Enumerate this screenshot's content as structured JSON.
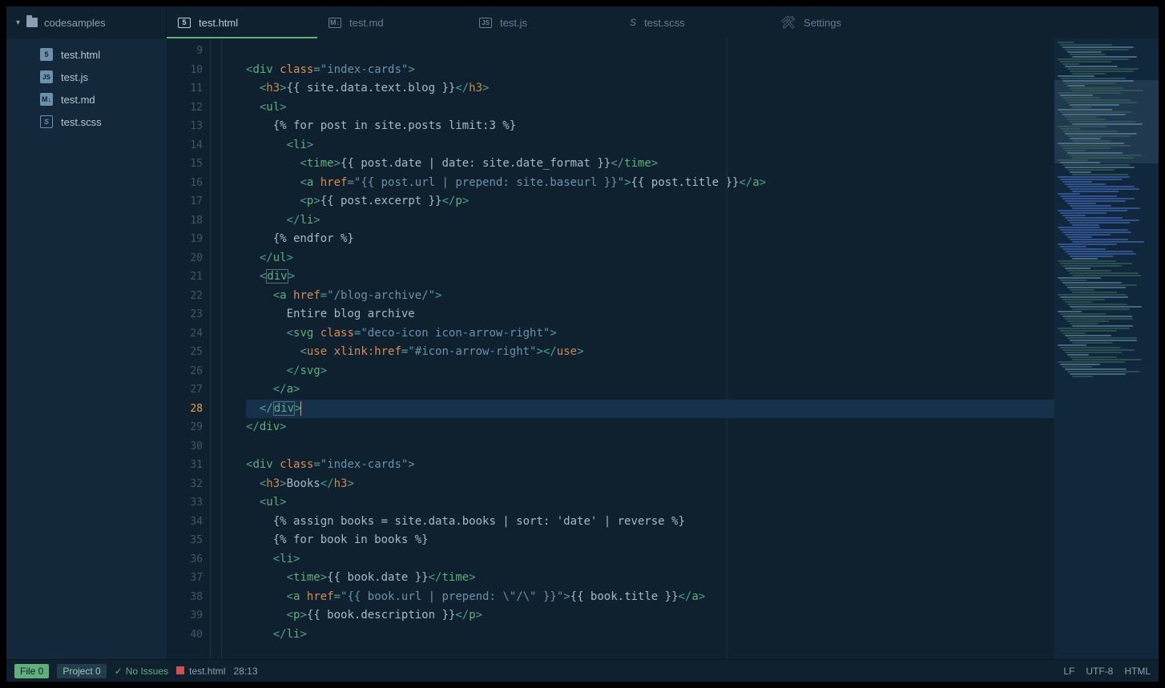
{
  "project": {
    "name": "codesamples"
  },
  "tabs": [
    {
      "label": "test.html",
      "icon": "5",
      "cls": "html",
      "active": true
    },
    {
      "label": "test.md",
      "icon": "M↓",
      "cls": "md"
    },
    {
      "label": "test.js",
      "icon": "JS",
      "cls": "js"
    },
    {
      "label": "test.scss",
      "icon": "S",
      "cls": "scss"
    },
    {
      "label": "Settings",
      "icon": "✕",
      "cls": "settings"
    }
  ],
  "files": [
    {
      "label": "test.html",
      "icon": "5",
      "cls": "html"
    },
    {
      "label": "test.js",
      "icon": "JS",
      "cls": "js"
    },
    {
      "label": "test.md",
      "icon": "M↓",
      "cls": "md"
    },
    {
      "label": "test.scss",
      "icon": "S",
      "cls": "scss"
    }
  ],
  "lines": {
    "start": 9,
    "end": 40,
    "active": 28
  },
  "code_lines": [
    {
      "n": 9,
      "indent": 0,
      "segs": []
    },
    {
      "n": 10,
      "indent": 0,
      "segs": [
        [
          "p",
          "<"
        ],
        [
          "tg",
          "div"
        ],
        [
          "tx",
          " "
        ],
        [
          "at",
          "class"
        ],
        [
          "p",
          "="
        ],
        [
          "st",
          "\"index-cards\""
        ],
        [
          "p",
          ">"
        ]
      ]
    },
    {
      "n": 11,
      "indent": 1,
      "segs": [
        [
          "p",
          "<"
        ],
        [
          "tg2",
          "h3"
        ],
        [
          "p",
          ">"
        ],
        [
          "tx",
          "{{ site.data.text.blog }}"
        ],
        [
          "p",
          "</"
        ],
        [
          "tg2",
          "h3"
        ],
        [
          "p",
          ">"
        ]
      ]
    },
    {
      "n": 12,
      "indent": 1,
      "segs": [
        [
          "p",
          "<"
        ],
        [
          "tg",
          "ul"
        ],
        [
          "p",
          ">"
        ]
      ]
    },
    {
      "n": 13,
      "indent": 2,
      "segs": [
        [
          "tx",
          "{% for post in site.posts limit:3 %}"
        ]
      ]
    },
    {
      "n": 14,
      "indent": 3,
      "segs": [
        [
          "p",
          "<"
        ],
        [
          "tg",
          "li"
        ],
        [
          "p",
          ">"
        ]
      ]
    },
    {
      "n": 15,
      "indent": 4,
      "segs": [
        [
          "p",
          "<"
        ],
        [
          "tg",
          "time"
        ],
        [
          "p",
          ">"
        ],
        [
          "tx",
          "{{ post.date | date: site.date_format }}"
        ],
        [
          "p",
          "</"
        ],
        [
          "tg",
          "time"
        ],
        [
          "p",
          ">"
        ]
      ]
    },
    {
      "n": 16,
      "indent": 4,
      "segs": [
        [
          "p",
          "<"
        ],
        [
          "tg",
          "a"
        ],
        [
          "tx",
          " "
        ],
        [
          "at",
          "href"
        ],
        [
          "p",
          "="
        ],
        [
          "st",
          "\"{{ post.url | prepend: site.baseurl }}\""
        ],
        [
          "p",
          ">"
        ],
        [
          "tx",
          "{{ post.title }}"
        ],
        [
          "p",
          "</"
        ],
        [
          "tg",
          "a"
        ],
        [
          "p",
          ">"
        ]
      ]
    },
    {
      "n": 17,
      "indent": 4,
      "segs": [
        [
          "p",
          "<"
        ],
        [
          "tg",
          "p"
        ],
        [
          "p",
          ">"
        ],
        [
          "tx",
          "{{ post.excerpt }}"
        ],
        [
          "p",
          "</"
        ],
        [
          "tg",
          "p"
        ],
        [
          "p",
          ">"
        ]
      ]
    },
    {
      "n": 18,
      "indent": 3,
      "segs": [
        [
          "p",
          "</"
        ],
        [
          "tg",
          "li"
        ],
        [
          "p",
          ">"
        ]
      ]
    },
    {
      "n": 19,
      "indent": 2,
      "segs": [
        [
          "tx",
          "{% endfor %}"
        ]
      ]
    },
    {
      "n": 20,
      "indent": 1,
      "segs": [
        [
          "p",
          "</"
        ],
        [
          "tg",
          "ul"
        ],
        [
          "p",
          ">"
        ]
      ]
    },
    {
      "n": 21,
      "indent": 1,
      "segs": [
        [
          "p",
          "<"
        ],
        [
          "match",
          "div"
        ],
        [
          "p",
          ">"
        ]
      ]
    },
    {
      "n": 22,
      "indent": 2,
      "segs": [
        [
          "p",
          "<"
        ],
        [
          "tg",
          "a"
        ],
        [
          "tx",
          " "
        ],
        [
          "at",
          "href"
        ],
        [
          "p",
          "="
        ],
        [
          "st",
          "\"/blog-archive/\""
        ],
        [
          "p",
          ">"
        ]
      ]
    },
    {
      "n": 23,
      "indent": 3,
      "segs": [
        [
          "tx",
          "Entire blog archive"
        ]
      ]
    },
    {
      "n": 24,
      "indent": 3,
      "segs": [
        [
          "p",
          "<"
        ],
        [
          "tg",
          "svg"
        ],
        [
          "tx",
          " "
        ],
        [
          "at",
          "class"
        ],
        [
          "p",
          "="
        ],
        [
          "st",
          "\"deco-icon icon-arrow-right\""
        ],
        [
          "p",
          ">"
        ]
      ]
    },
    {
      "n": 25,
      "indent": 4,
      "segs": [
        [
          "p",
          "<"
        ],
        [
          "tg2",
          "use"
        ],
        [
          "tx",
          " "
        ],
        [
          "at",
          "xlink:href"
        ],
        [
          "p",
          "="
        ],
        [
          "st",
          "\"#icon-arrow-right\""
        ],
        [
          "p",
          "></"
        ],
        [
          "tg2",
          "use"
        ],
        [
          "p",
          ">"
        ]
      ]
    },
    {
      "n": 26,
      "indent": 3,
      "segs": [
        [
          "p",
          "</"
        ],
        [
          "tg",
          "svg"
        ],
        [
          "p",
          ">"
        ]
      ]
    },
    {
      "n": 27,
      "indent": 2,
      "segs": [
        [
          "p",
          "</"
        ],
        [
          "tg",
          "a"
        ],
        [
          "p",
          ">"
        ]
      ]
    },
    {
      "n": 28,
      "indent": 1,
      "segs": [
        [
          "p",
          "</"
        ],
        [
          "match",
          "div"
        ],
        [
          "p",
          ">"
        ],
        [
          "cursor",
          ""
        ]
      ],
      "active": true
    },
    {
      "n": 29,
      "indent": 0,
      "segs": [
        [
          "p",
          "</"
        ],
        [
          "tg",
          "div"
        ],
        [
          "p",
          ">"
        ]
      ]
    },
    {
      "n": 30,
      "indent": 0,
      "segs": []
    },
    {
      "n": 31,
      "indent": 0,
      "segs": [
        [
          "p",
          "<"
        ],
        [
          "tg",
          "div"
        ],
        [
          "tx",
          " "
        ],
        [
          "at",
          "class"
        ],
        [
          "p",
          "="
        ],
        [
          "st",
          "\"index-cards\""
        ],
        [
          "p",
          ">"
        ]
      ]
    },
    {
      "n": 32,
      "indent": 1,
      "segs": [
        [
          "p",
          "<"
        ],
        [
          "tg2",
          "h3"
        ],
        [
          "p",
          ">"
        ],
        [
          "tx",
          "Books"
        ],
        [
          "p",
          "</"
        ],
        [
          "tg2",
          "h3"
        ],
        [
          "p",
          ">"
        ]
      ]
    },
    {
      "n": 33,
      "indent": 1,
      "segs": [
        [
          "p",
          "<"
        ],
        [
          "tg",
          "ul"
        ],
        [
          "p",
          ">"
        ]
      ]
    },
    {
      "n": 34,
      "indent": 2,
      "segs": [
        [
          "tx",
          "{% assign books = site.data.books | sort: 'date' | reverse %}"
        ]
      ]
    },
    {
      "n": 35,
      "indent": 2,
      "segs": [
        [
          "tx",
          "{% for book in books %}"
        ]
      ]
    },
    {
      "n": 36,
      "indent": 2,
      "segs": [
        [
          "p",
          "<"
        ],
        [
          "tg",
          "li"
        ],
        [
          "p",
          ">"
        ]
      ]
    },
    {
      "n": 37,
      "indent": 3,
      "segs": [
        [
          "p",
          "<"
        ],
        [
          "tg",
          "time"
        ],
        [
          "p",
          ">"
        ],
        [
          "tx",
          "{{ book.date }}"
        ],
        [
          "p",
          "</"
        ],
        [
          "tg",
          "time"
        ],
        [
          "p",
          ">"
        ]
      ]
    },
    {
      "n": 38,
      "indent": 3,
      "segs": [
        [
          "p",
          "<"
        ],
        [
          "tg",
          "a"
        ],
        [
          "tx",
          " "
        ],
        [
          "at",
          "href"
        ],
        [
          "p",
          "="
        ],
        [
          "st",
          "\"{{ book.url | prepend: \\\"/\\\" }}\""
        ],
        [
          "p",
          ">"
        ],
        [
          "tx",
          "{{ book.title }}"
        ],
        [
          "p",
          "</"
        ],
        [
          "tg",
          "a"
        ],
        [
          "p",
          ">"
        ]
      ]
    },
    {
      "n": 39,
      "indent": 3,
      "segs": [
        [
          "p",
          "<"
        ],
        [
          "tg",
          "p"
        ],
        [
          "p",
          ">"
        ],
        [
          "tx",
          "{{ book.description }}"
        ],
        [
          "p",
          "</"
        ],
        [
          "tg",
          "p"
        ],
        [
          "p",
          ">"
        ]
      ]
    },
    {
      "n": 40,
      "indent": 2,
      "segs": [
        [
          "p",
          "</"
        ],
        [
          "tg",
          "li"
        ],
        [
          "p",
          ">"
        ]
      ]
    }
  ],
  "status": {
    "file_issues": "File 0",
    "project_issues": "Project 0",
    "no_issues": "No Issues",
    "filename": "test.html",
    "cursor": "28:13",
    "eol": "LF",
    "encoding": "UTF-8",
    "grammar": "HTML"
  }
}
